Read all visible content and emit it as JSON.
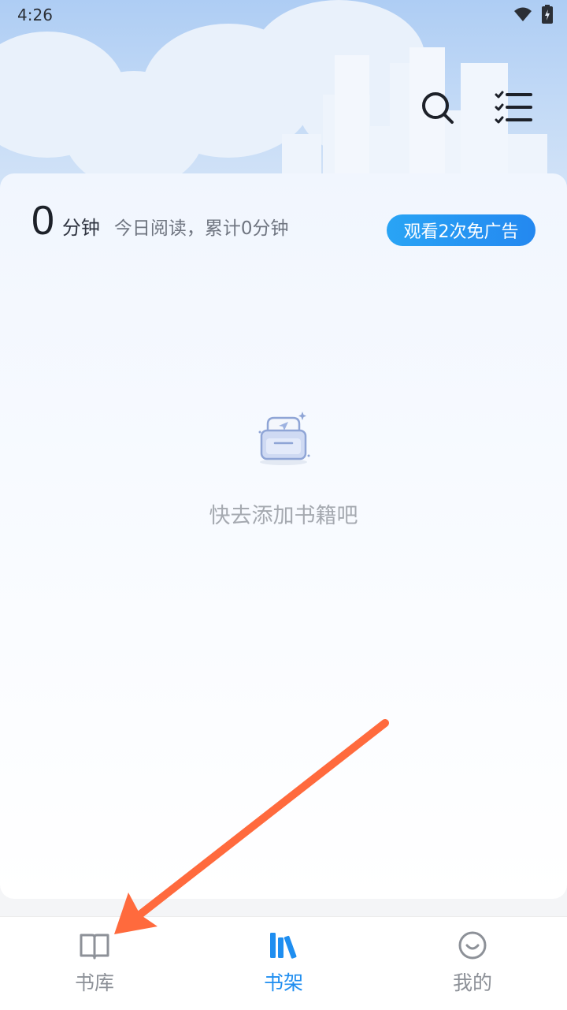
{
  "status_bar": {
    "time": "4:26"
  },
  "header": {
    "search_icon": "search-icon",
    "manage_icon": "list-check-icon"
  },
  "reading_stats": {
    "minutes_value": "0",
    "minutes_unit": "分钟",
    "description": "今日阅读，累计0分钟",
    "ad_button_label": "观看2次免广告"
  },
  "empty_state": {
    "icon": "empty-box-icon",
    "text": "快去添加书籍吧"
  },
  "tab_bar": {
    "active_color": "#1f8ef0",
    "inactive_color": "#8d9198",
    "tabs": [
      {
        "label": "书库",
        "icon": "open-book-icon",
        "active": false
      },
      {
        "label": "书架",
        "icon": "bookshelf-icon",
        "active": true
      },
      {
        "label": "我的",
        "icon": "smiley-icon",
        "active": false
      }
    ]
  },
  "annotation": {
    "arrow_color": "#ff6a3d"
  }
}
